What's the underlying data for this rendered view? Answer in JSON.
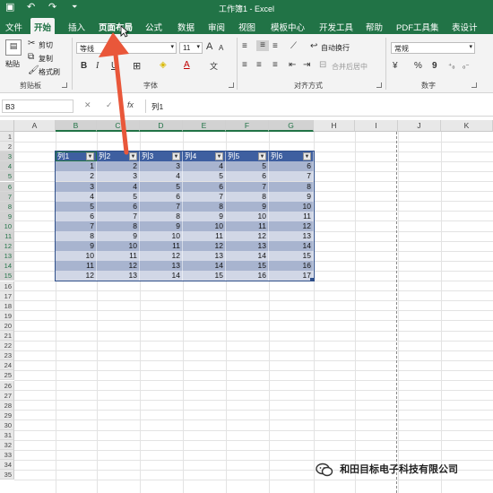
{
  "titlebar": {
    "title": "工作簿1 - Excel",
    "qa_save": "▣",
    "qa_undo": "↶",
    "qa_redo": "↷",
    "qa_more": "⏷"
  },
  "tabs": [
    {
      "label": "文件"
    },
    {
      "label": "开始"
    },
    {
      "label": "插入"
    },
    {
      "label": "页面布局"
    },
    {
      "label": "公式"
    },
    {
      "label": "数据"
    },
    {
      "label": "审阅"
    },
    {
      "label": "视图"
    },
    {
      "label": "模板中心"
    },
    {
      "label": "开发工具"
    },
    {
      "label": "帮助"
    },
    {
      "label": "PDF工具集"
    },
    {
      "label": "表设计"
    }
  ],
  "ribbon": {
    "clipboard": {
      "paste": "粘贴",
      "cut": "剪切",
      "copy": "复制",
      "format_painter": "格式刷",
      "group_label": "剪贴板"
    },
    "font": {
      "font_name": "等线",
      "font_size": "11",
      "bold": "B",
      "italic": "I",
      "underline": "U",
      "grow": "A",
      "shrink": "A",
      "font_color": "A",
      "phonetic": "文",
      "group_label": "字体"
    },
    "alignment": {
      "wrap_text": "自动换行",
      "merge_center": "合并后居中",
      "group_label": "对齐方式"
    },
    "number": {
      "format": "常规",
      "currency": "¥",
      "percent": "%",
      "comma": "9",
      "group_label": "数字"
    }
  },
  "formula_bar": {
    "name_box": "B3",
    "cancel": "✕",
    "enter": "✓",
    "fx": "fx",
    "content": "列1"
  },
  "columns": [
    "A",
    "B",
    "C",
    "D",
    "E",
    "F",
    "G",
    "H",
    "I",
    "J",
    "K"
  ],
  "rows": [
    "1",
    "2",
    "3",
    "4",
    "5",
    "6",
    "7",
    "8",
    "9",
    "10",
    "11",
    "12",
    "13",
    "14",
    "15",
    "16",
    "17",
    "18",
    "19",
    "20",
    "21",
    "22",
    "23",
    "24",
    "25",
    "26",
    "27",
    "28",
    "29",
    "30",
    "31",
    "32",
    "33",
    "34",
    "35"
  ],
  "table": {
    "headers": [
      "列1",
      "列2",
      "列3",
      "列4",
      "列5",
      "列6"
    ],
    "rows": [
      [
        1,
        2,
        3,
        4,
        5,
        6
      ],
      [
        2,
        3,
        4,
        5,
        6,
        7
      ],
      [
        3,
        4,
        5,
        6,
        7,
        8
      ],
      [
        4,
        5,
        6,
        7,
        8,
        9
      ],
      [
        5,
        6,
        7,
        8,
        9,
        10
      ],
      [
        6,
        7,
        8,
        9,
        10,
        11
      ],
      [
        7,
        8,
        9,
        10,
        11,
        12
      ],
      [
        8,
        9,
        10,
        11,
        12,
        13
      ],
      [
        9,
        10,
        11,
        12,
        13,
        14
      ],
      [
        10,
        11,
        12,
        13,
        14,
        15
      ],
      [
        11,
        12,
        13,
        14,
        15,
        16
      ],
      [
        12,
        13,
        14,
        15,
        16,
        17
      ]
    ]
  },
  "colors": {
    "excel_green": "#217346",
    "table_header": "#3e5fa0",
    "band_dark": "#a8b4cf",
    "band_light": "#d1d7e6",
    "arrow": "#e9573a"
  },
  "watermark": {
    "text": "和田目标电子科技有限公司"
  }
}
